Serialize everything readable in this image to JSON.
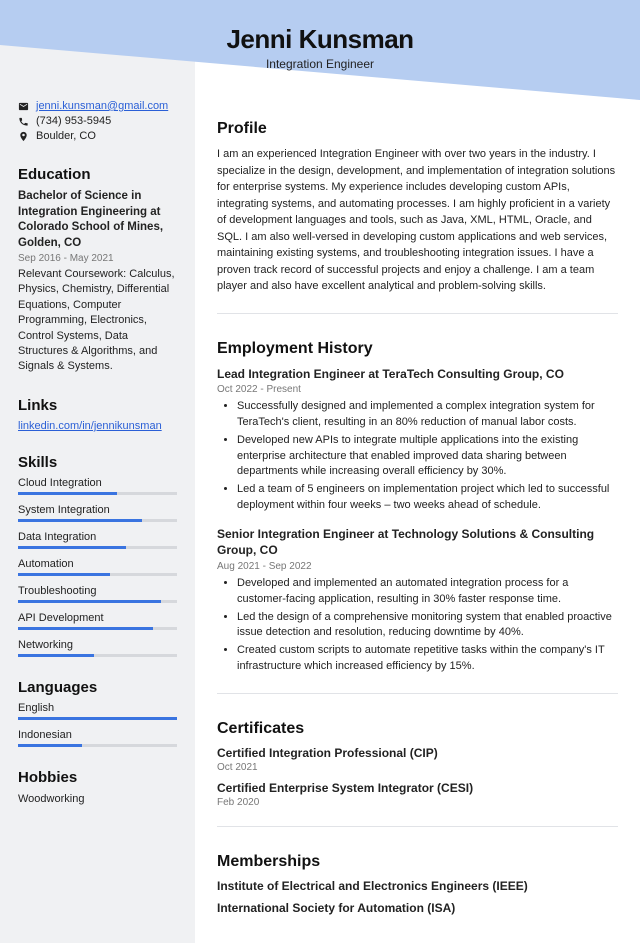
{
  "header": {
    "name": "Jenni Kunsman",
    "title": "Integration Engineer"
  },
  "contact": {
    "email": "jenni.kunsman@gmail.com",
    "phone": "(734) 953-5945",
    "location": "Boulder, CO"
  },
  "education": {
    "heading": "Education",
    "degree": "Bachelor of Science in Integration Engineering at Colorado School of Mines, Golden, CO",
    "dates": "Sep 2016 - May 2021",
    "coursework": "Relevant Coursework: Calculus, Physics, Chemistry, Differential Equations, Computer Programming, Electronics, Control Systems, Data Structures & Algorithms, and Signals & Systems."
  },
  "links": {
    "heading": "Links",
    "items": [
      "linkedin.com/in/jennikunsman"
    ]
  },
  "skills": {
    "heading": "Skills",
    "items": [
      {
        "name": "Cloud Integration",
        "level": 62
      },
      {
        "name": "System Integration",
        "level": 78
      },
      {
        "name": "Data Integration",
        "level": 68
      },
      {
        "name": "Automation",
        "level": 58
      },
      {
        "name": "Troubleshooting",
        "level": 90
      },
      {
        "name": "API Development",
        "level": 85
      },
      {
        "name": "Networking",
        "level": 48
      }
    ]
  },
  "languages": {
    "heading": "Languages",
    "items": [
      {
        "name": "English",
        "level": 100
      },
      {
        "name": "Indonesian",
        "level": 40
      }
    ]
  },
  "hobbies": {
    "heading": "Hobbies",
    "items": [
      "Woodworking"
    ]
  },
  "profile": {
    "heading": "Profile",
    "text": "I am an experienced Integration Engineer with over two years in the industry. I specialize in the design, development, and implementation of integration solutions for enterprise systems. My experience includes developing custom APIs, integrating systems, and automating processes. I am highly proficient in a variety of development languages and tools, such as Java, XML, HTML, Oracle, and SQL. I am also well-versed in developing custom applications and web services, maintaining existing systems, and troubleshooting integration issues. I have a proven track record of successful projects and enjoy a challenge. I am a team player and also have excellent analytical and problem-solving skills."
  },
  "employment": {
    "heading": "Employment History",
    "jobs": [
      {
        "title": "Lead Integration Engineer at TeraTech Consulting Group, CO",
        "dates": "Oct 2022 - Present",
        "bullets": [
          "Successfully designed and implemented a complex integration system for TeraTech's client, resulting in an 80% reduction of manual labor costs.",
          "Developed new APIs to integrate multiple applications into the existing enterprise architecture that enabled improved data sharing between departments while increasing overall efficiency by 30%.",
          "Led a team of 5 engineers on implementation project which led to successful deployment within four weeks – two weeks ahead of schedule."
        ]
      },
      {
        "title": "Senior Integration Engineer at Technology Solutions & Consulting Group, CO",
        "dates": "Aug 2021 - Sep 2022",
        "bullets": [
          "Developed and implemented an automated integration process for a customer-facing application, resulting in 30% faster response time.",
          "Led the design of a comprehensive monitoring system that enabled proactive issue detection and resolution, reducing downtime by 40%.",
          "Created custom scripts to automate repetitive tasks within the company's IT infrastructure which increased efficiency by 15%."
        ]
      }
    ]
  },
  "certificates": {
    "heading": "Certificates",
    "items": [
      {
        "title": "Certified Integration Professional (CIP)",
        "date": "Oct 2021"
      },
      {
        "title": "Certified Enterprise System Integrator (CESI)",
        "date": "Feb 2020"
      }
    ]
  },
  "memberships": {
    "heading": "Memberships",
    "items": [
      "Institute of Electrical and Electronics Engineers (IEEE)",
      "International Society for Automation (ISA)"
    ]
  }
}
